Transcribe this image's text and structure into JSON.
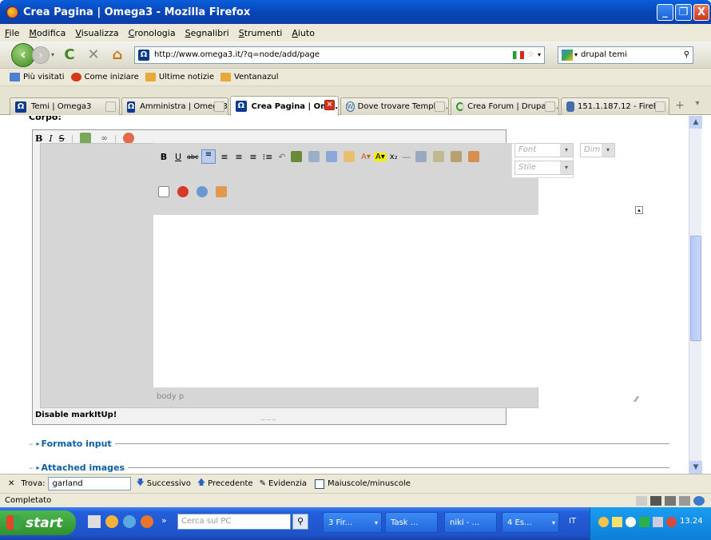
{
  "window": {
    "title": "Crea Pagina | Omega3 - Mozilla Firefox",
    "min": "_",
    "max": "❐",
    "close": "X"
  },
  "menu": [
    "File",
    "Modifica",
    "Visualizza",
    "Cronologia",
    "Segnalibri",
    "Strumenti",
    "Aiuto"
  ],
  "nav": {
    "url": "http://www.omega3.it/?q=node/add/page",
    "search": "drupal temi"
  },
  "bookmarks": [
    {
      "label": "Più visitati",
      "color": "#4d7fcf"
    },
    {
      "label": "Come iniziare",
      "color": "#d23a1a"
    },
    {
      "label": "Ultime notizie",
      "color": "#e8a93a"
    },
    {
      "label": "Ventanazul",
      "color": "#e8a93a"
    }
  ],
  "tabs": [
    {
      "label": "Temi | Omega3"
    },
    {
      "label": "Amministra | Omega3"
    },
    {
      "label": "Crea Pagina | Om..."
    },
    {
      "label": "Dove trovare Templa..."
    },
    {
      "label": "Crea Forum | Drupal ..."
    },
    {
      "label": "151.1.187.12 - FireF..."
    }
  ],
  "editor": {
    "section_label": "Corpo:",
    "font_placeholder": "Font",
    "size_placeholder": "Dim",
    "style_placeholder": "Stile",
    "status_path": "body  p",
    "disable_link": "Disable markItUp!",
    "resize_grip": "~~~"
  },
  "fieldsets": [
    "Formato input",
    "Attached images"
  ],
  "find": {
    "label": "Trova:",
    "value": "garland",
    "next": "Successivo",
    "prev": "Precedente",
    "highlight": "Evidenzia",
    "case": "Maiuscole/minuscole"
  },
  "status": "Completato",
  "taskbar": {
    "start": "start",
    "search_placeholder": "Cerca sul PC",
    "buttons": [
      "3 Fir...",
      "Task ...",
      "niki - ...",
      "4 Es...",
      "IT"
    ],
    "clock": "13.24"
  }
}
